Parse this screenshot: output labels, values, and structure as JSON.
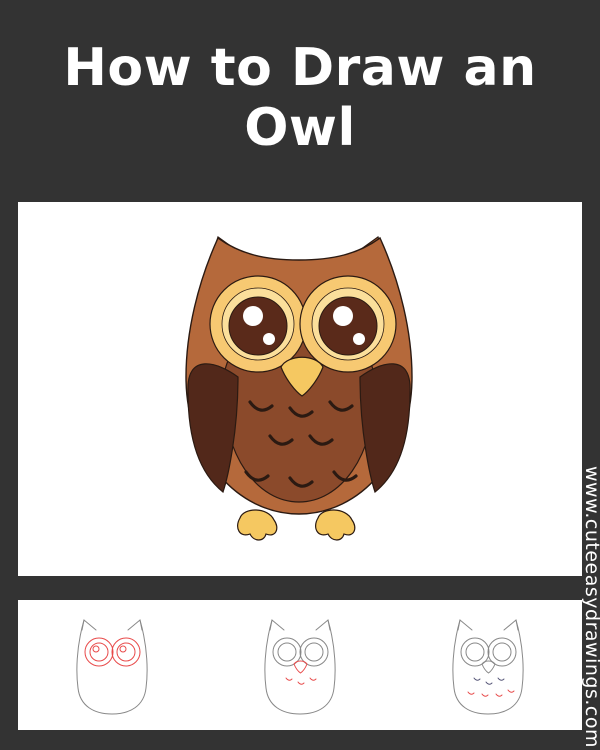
{
  "title": {
    "line1": "How to Draw an",
    "line2": "Owl"
  },
  "watermark": "www.cuteeasydrawings.com",
  "colors": {
    "background": "#333333",
    "panel": "#ffffff",
    "owl_body": "#b5693b",
    "owl_wing": "#52281a",
    "owl_belly": "#8b4a2b",
    "eye_ring": "#f7c972",
    "eye_inner": "#fbdf9b",
    "pupil": "#5a2a1a",
    "beak_feet": "#f5c861",
    "sketch_red": "#e84a4a",
    "sketch_gray": "#888888"
  },
  "steps_shown": 3
}
